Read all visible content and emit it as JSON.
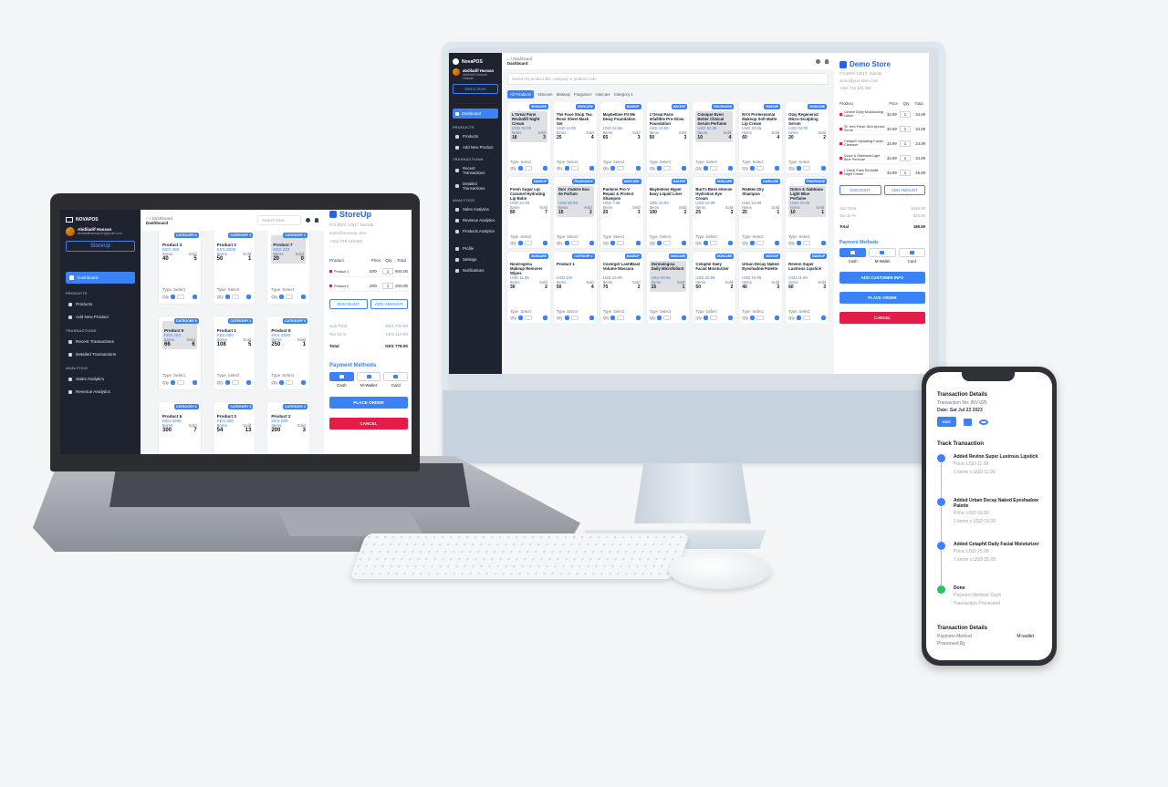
{
  "monitor": {
    "breadcrumb": "⌂ / Dashboard",
    "page_title": "Dashboard",
    "search_placeholder": "Search by product title, category or product code",
    "sidebar": {
      "brand": "NovaPOS",
      "user_name": "abdiladif Hassan",
      "user_role": "Abdiladif Hassan Hassan",
      "store": "Demo Store",
      "active": "Dashboard",
      "sections": [
        {
          "title": "PRODUCTS",
          "items": [
            "Products",
            "Add New Product"
          ]
        },
        {
          "title": "TRANSACTIONS",
          "items": [
            "Recent Transactions",
            "Detailed Transactions"
          ]
        },
        {
          "title": "ANALYTICS",
          "items": [
            "Sales Analytics",
            "Revenue Analytics",
            "Products Analytics"
          ]
        },
        {
          "title": "",
          "items": [
            "Profile",
            "Settings",
            "Notifications"
          ]
        }
      ]
    },
    "tabs": [
      "All Products",
      "Skincare",
      "Makeup",
      "Fragrance",
      "Haircare",
      "Category 1"
    ],
    "labels": {
      "items": "Items",
      "sold": "Sold",
      "type": "Type",
      "select": "Select",
      "qty": "Qty"
    },
    "products": [
      {
        "name": "L'Oreal Paris Revitalift Night Cream",
        "price": "USD 34.99",
        "items": "18",
        "sold": "3",
        "badge": "SKINCARE",
        "grey": true
      },
      {
        "name": "The Face Shop Tea Rose Sheet Mask Set",
        "price": "USD 12.99",
        "items": "25",
        "sold": "4",
        "badge": "SKINCARE",
        "grey": false
      },
      {
        "name": "Maybelline Fit Me Dewy Foundation",
        "price": "USD 22.99",
        "items": "65",
        "sold": "3",
        "badge": "MAKEUP",
        "grey": false
      },
      {
        "name": "L'Oreal Paris Infallible Pro-Glow Foundation",
        "price": "USD 16.99",
        "items": "50",
        "sold": "3",
        "badge": "MAKEUP",
        "grey": false
      },
      {
        "name": "Clinique Even Better Clinical Serum Perfume",
        "price": "USD 54.99",
        "items": "10",
        "sold": "4",
        "badge": "FRAGRANCE",
        "grey": true
      },
      {
        "name": "NYX Professional Makeup Soft Matte Lip Cream",
        "price": "USD 24.99",
        "items": "60",
        "sold": "4",
        "badge": "MAKEUP",
        "grey": false
      },
      {
        "name": "Olay Regenerist Micro-Sculpting Serum",
        "price": "USD 34.99",
        "items": "20",
        "sold": "2",
        "badge": "SKINCARE",
        "grey": false
      },
      {
        "name": "Fresh Sugar Lip Caramel Hydrating Lip Balm",
        "price": "USD 24.99",
        "items": "80",
        "sold": "7",
        "badge": "MAKEUP",
        "grey": false
      },
      {
        "name": "Dior J'adore Eau de Parfum",
        "price": "USD 99.99",
        "items": "15",
        "sold": "3",
        "badge": "FRAGRANCE",
        "grey": true
      },
      {
        "name": "Pantene Pro-V Repair & Protect Shampoo",
        "price": "USD 7.99",
        "items": "20",
        "sold": "3",
        "badge": "HAIRCARE",
        "grey": false
      },
      {
        "name": "Maybelline Hyper Easy Liquid Liner",
        "price": "USD 10.99",
        "items": "100",
        "sold": "2",
        "badge": "MAKEUP",
        "grey": false
      },
      {
        "name": "Burt's Bees Intense Hydration Eye Cream",
        "price": "USD 12.99",
        "items": "25",
        "sold": "3",
        "badge": "SKINCARE",
        "grey": false
      },
      {
        "name": "Redken Dry Shampoo",
        "price": "USD 24.99",
        "items": "25",
        "sold": "1",
        "badge": "HAIRCARE",
        "grey": false
      },
      {
        "name": "Dolce & Gabbana Light Blue Perfume",
        "price": "USD 34.99",
        "items": "10",
        "sold": "1",
        "badge": "FRAGRANCE",
        "grey": true
      },
      {
        "name": "Neutrogena Makeup Remover Wipes",
        "price": "USD 11.99",
        "items": "30",
        "sold": "2",
        "badge": "SKINCARE",
        "grey": false
      },
      {
        "name": "Product 1",
        "price": "USD 100",
        "items": "50",
        "sold": "4",
        "badge": "CATEGORY 1",
        "grey": false
      },
      {
        "name": "Covergirl LashBlast Volume Mascara",
        "price": "USD 16.99",
        "items": "70",
        "sold": "2",
        "badge": "MAKEUP",
        "grey": false
      },
      {
        "name": "Dermalogica Daily Microfoliant",
        "price": "USD 69.99",
        "items": "15",
        "sold": "1",
        "badge": "SKINCARE",
        "grey": true
      },
      {
        "name": "Cetaphil Daily Facial Moisturizer",
        "price": "USD 25.99",
        "items": "50",
        "sold": "2",
        "badge": "SKINCARE",
        "grey": false
      },
      {
        "name": "Urban Decay Naked Eyeshadow Palette",
        "price": "USD 19.99",
        "items": "40",
        "sold": "3",
        "badge": "MAKEUP",
        "grey": false
      },
      {
        "name": "Revlon Super Lustrous Lipstick",
        "price": "USD 11.99",
        "items": "60",
        "sold": "3",
        "badge": "MAKEUP",
        "grey": false
      }
    ],
    "order": {
      "store_name": "Demo Store",
      "store_lines": [
        "P.O.BOX 12517, Nairobi",
        "demo@pos-store.com",
        "+254 722 123 456"
      ],
      "header": {
        "product": "Product",
        "price": "Price",
        "qty": "Qty",
        "total": "Total"
      },
      "lines": [
        {
          "name": "Cerave Daily Moisturizing Lotion",
          "price": "34.99",
          "qty": "1",
          "total": "34.99"
        },
        {
          "name": "St. Ives Fresh Skin Apricot Scrub",
          "price": "34.99",
          "qty": "1",
          "total": "34.99"
        },
        {
          "name": "Cetaphil Hydrating Facial Cleanser",
          "price": "34.99",
          "qty": "1",
          "total": "34.99"
        },
        {
          "name": "Dolce & Gabbana Light Blue Perfume",
          "price": "34.99",
          "qty": "1",
          "total": "34.99"
        },
        {
          "name": "L'Oreal Paris Revitalift Night Cream",
          "price": "45.99",
          "qty": "1",
          "total": "45.99"
        }
      ],
      "discount_label": "DISCOUNT",
      "add_amount_label": "ADD AMOUNT",
      "subtotal_label": "Sub Total",
      "subtotal_value": "$160.99",
      "tax_label": "Tax 16 %",
      "tax_value": "$25.60",
      "total_label": "Total",
      "total_value": "186.59",
      "payment_title": "Payment Methods",
      "payments": [
        "Cash",
        "M-Wallet",
        "Card"
      ],
      "add_customer": "ADD CUSTOMER INFO",
      "place_order": "PLACE ORDER",
      "cancel": "CANCEL"
    }
  },
  "laptop": {
    "breadcrumb": "⌂ / Dashboard",
    "page_title": "Dashboard",
    "search_placeholder": "Search here",
    "sidebar": {
      "brand": "NOVAPOS",
      "user_name": "Abdiladif Hassan",
      "user_email": "abdiladifhassan11@gmail.com",
      "store": "StoreUp",
      "active": "Dashboard",
      "sections": [
        {
          "title": "PRODUCTS",
          "items": [
            "Products",
            "Add New Product"
          ]
        },
        {
          "title": "TRANSACTIONS",
          "items": [
            "Recent Transactions",
            "Detailed Transactions"
          ]
        },
        {
          "title": "ANALYTICS",
          "items": [
            "Sales Analytics",
            "Revenue Analytics"
          ]
        }
      ]
    },
    "labels": {
      "items": "Items",
      "sold": "Sold",
      "type": "Type",
      "select": "Select",
      "qty": "Qty"
    },
    "products": [
      {
        "name": "Product 4",
        "price": "KES 400",
        "items": "40",
        "sold": "5",
        "badge": "CATEGORY 4",
        "grey": false
      },
      {
        "name": "Product 3",
        "price": "KES 2000",
        "items": "50",
        "sold": "1",
        "badge": "CATEGORY 3",
        "grey": false
      },
      {
        "name": "Product 7",
        "price": "KES 222",
        "items": "20",
        "sold": "0",
        "badge": "CATEGORY 1",
        "grey": true
      },
      {
        "name": "Product 5",
        "price": "KES 152",
        "items": "66",
        "sold": "6",
        "badge": "CATEGORY 5",
        "grey": true
      },
      {
        "name": "Product 1",
        "price": "KES 500",
        "items": "108",
        "sold": "5",
        "badge": "CATEGORY 1",
        "grey": false
      },
      {
        "name": "Product 8",
        "price": "KES 1500",
        "items": "250",
        "sold": "1",
        "badge": "CATEGORY 3",
        "grey": false
      },
      {
        "name": "Product 6",
        "price": "KES 2000",
        "items": "300",
        "sold": "7",
        "badge": "CATEGORY 6",
        "grey": false
      },
      {
        "name": "Product 3",
        "price": "KES 300",
        "items": "54",
        "sold": "13",
        "badge": "CATEGORY 3",
        "grey": false
      },
      {
        "name": "Product 2",
        "price": "KES 200",
        "items": "200",
        "sold": "3",
        "badge": "CATEGORY 2",
        "grey": false
      }
    ],
    "order": {
      "store_name": "StoreUp",
      "store_lines": [
        "P.O.BOX 12517 Nairobi",
        "store@storeup.com",
        "+254 725 123456"
      ],
      "header": {
        "product": "Product",
        "price": "Price",
        "qty": "Qty",
        "total": "Total"
      },
      "lines": [
        {
          "name": "Product 1",
          "price": "500",
          "qty": "1",
          "total": "500.00"
        },
        {
          "name": "Product 2",
          "price": "200",
          "qty": "1",
          "total": "200.00"
        }
      ],
      "discount_label": "DISCOUNT",
      "add_amount_label": "ADD AMOUNT",
      "subtotal_label": "Sub Total",
      "subtotal_value": "KES 700.00",
      "tax_label": "Tax 16 %",
      "tax_value": "KES 112.00",
      "total_label": "Total",
      "total_value": "KES 778.00",
      "payment_title": "Payment Methods",
      "payments": [
        "Cash",
        "M-Wallet",
        "Card"
      ],
      "place_order": "PLACE ORDER",
      "cancel": "CANCEL"
    }
  },
  "phone": {
    "title": "Transaction Details",
    "transaction_no": "Transaction No: INV-025",
    "date": "Date: Sat Jul 22 2023",
    "edit_label": "EDIT",
    "track_title": "Track Transaction",
    "steps": [
      {
        "title": "Added Revlon Super Lustrous Lipstick",
        "sub": "Price: USD 11.99",
        "meta": "1 items x USD 11.99"
      },
      {
        "title": "Added Urban Decay Naked Eyeshadow Palette",
        "sub": "Price: USD 19.99",
        "meta": "1 items x USD 19.99"
      },
      {
        "title": "Added Cetaphil Daily Facial Moisturizer",
        "sub": "Price: USD 25.99",
        "meta": "1 items x USD 25.99"
      },
      {
        "title": "Done",
        "sub": "Payment Method: Cash",
        "meta": "Transaction Processed"
      }
    ],
    "details_title": "Transaction Details",
    "payment_method_label": "Payment Method",
    "payment_method_value": "M-wallet",
    "processed_by": "Processed By"
  },
  "colors": {
    "accent": "#3b82f6",
    "sidebar": "#1f2330",
    "danger": "#e11d48",
    "success": "#22c55e"
  }
}
